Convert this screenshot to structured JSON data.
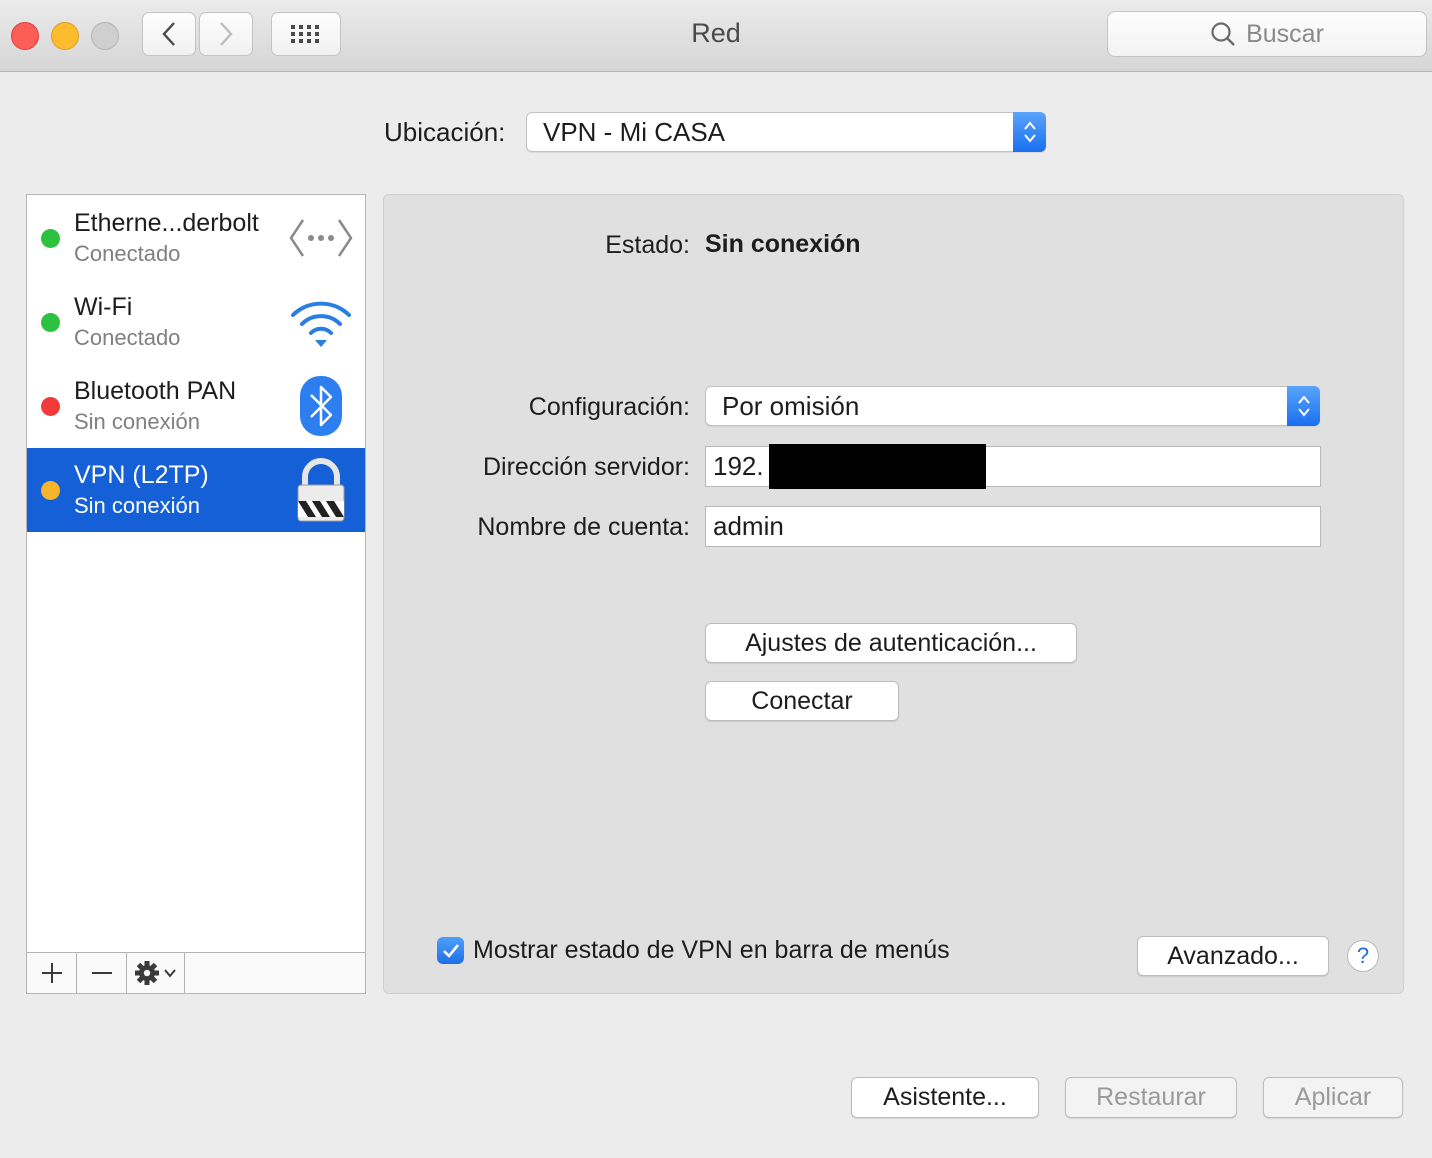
{
  "window": {
    "title": "Red",
    "search_placeholder": "Buscar"
  },
  "location": {
    "label": "Ubicación:",
    "value": "VPN - Mi CASA"
  },
  "services": [
    {
      "name": "Etherne...derbolt",
      "status": "Conectado",
      "dot_color": "#2cc13f",
      "icon": "ethernet-icon",
      "selected": false
    },
    {
      "name": "Wi-Fi",
      "status": "Conectado",
      "dot_color": "#2cc13f",
      "icon": "wifi-icon",
      "selected": false
    },
    {
      "name": "Bluetooth PAN",
      "status": "Sin conexión",
      "dot_color": "#f13b3b",
      "icon": "bluetooth-icon",
      "selected": false
    },
    {
      "name": "VPN (L2TP)",
      "status": "Sin conexión",
      "dot_color": "#f7b52c",
      "icon": "vpn-lock-icon",
      "selected": true
    }
  ],
  "detail": {
    "status_label": "Estado:",
    "status_value": "Sin conexión",
    "config_label": "Configuración:",
    "config_value": "Por omisión",
    "server_label": "Dirección servidor:",
    "server_value": "192.",
    "account_label": "Nombre de cuenta:",
    "account_value": "admin",
    "auth_button": "Ajustes de autenticación...",
    "connect_button": "Conectar",
    "show_vpn_status_label": "Mostrar estado de VPN en barra de menús",
    "show_vpn_status_checked": true,
    "advanced_button": "Avanzado...",
    "help_glyph": "?"
  },
  "footer": {
    "assistant_button": "Asistente...",
    "revert_button": "Restaurar",
    "apply_button": "Aplicar"
  },
  "colors": {
    "accent": "#1560d6",
    "window_bg": "#ececec"
  }
}
